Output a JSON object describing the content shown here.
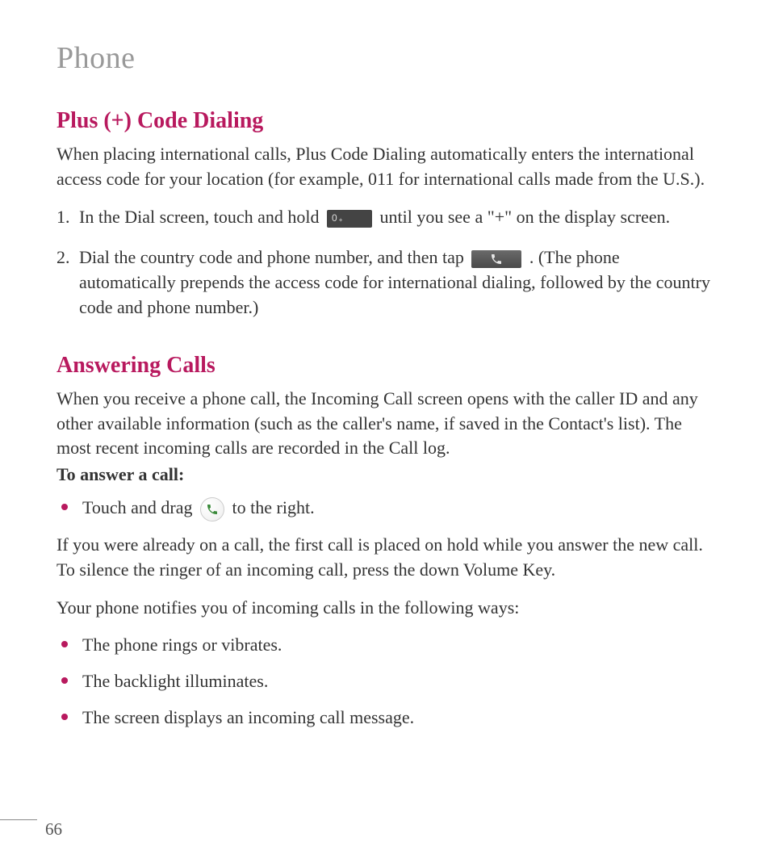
{
  "pageTitle": "Phone",
  "pageNumber": "66",
  "plusCode": {
    "heading": "Plus (+) Code Dialing",
    "intro": "When placing international calls, Plus Code Dialing automatically enters the international access code for your location (for example, 011 for international calls made from the U.S.).",
    "step1": {
      "num": "1.",
      "partA": "In the Dial screen, touch and hold ",
      "partB": " until you see a \"+\" on the display screen."
    },
    "step2": {
      "num": "2.",
      "partA": "Dial the country code and phone number, and then tap ",
      "partB": ". (The phone automatically prepends the access code for international dialing, followed by the country code and phone number.)"
    }
  },
  "answering": {
    "heading": "Answering Calls",
    "intro": "When you receive a phone call, the Incoming Call screen opens with the caller ID and any other available information (such as the caller's name, if saved in the Contact's list). The most recent incoming calls are recorded in the Call log.",
    "subheading": "To answer a call:",
    "dragStep": {
      "partA": "Touch and drag ",
      "partB": " to the right."
    },
    "holdPara": "If you were already on a call, the first call is placed on hold while you answer the new call. To silence the ringer of an incoming call, press the down Volume Key.",
    "notifyPara": "Your phone notifies you of incoming calls in the following ways:",
    "notifyList": [
      "The phone rings or vibrates.",
      "The backlight illuminates.",
      "The screen displays an incoming call message."
    ]
  },
  "icons": {
    "zeroKey": "0",
    "zeroKeySup": "+"
  }
}
